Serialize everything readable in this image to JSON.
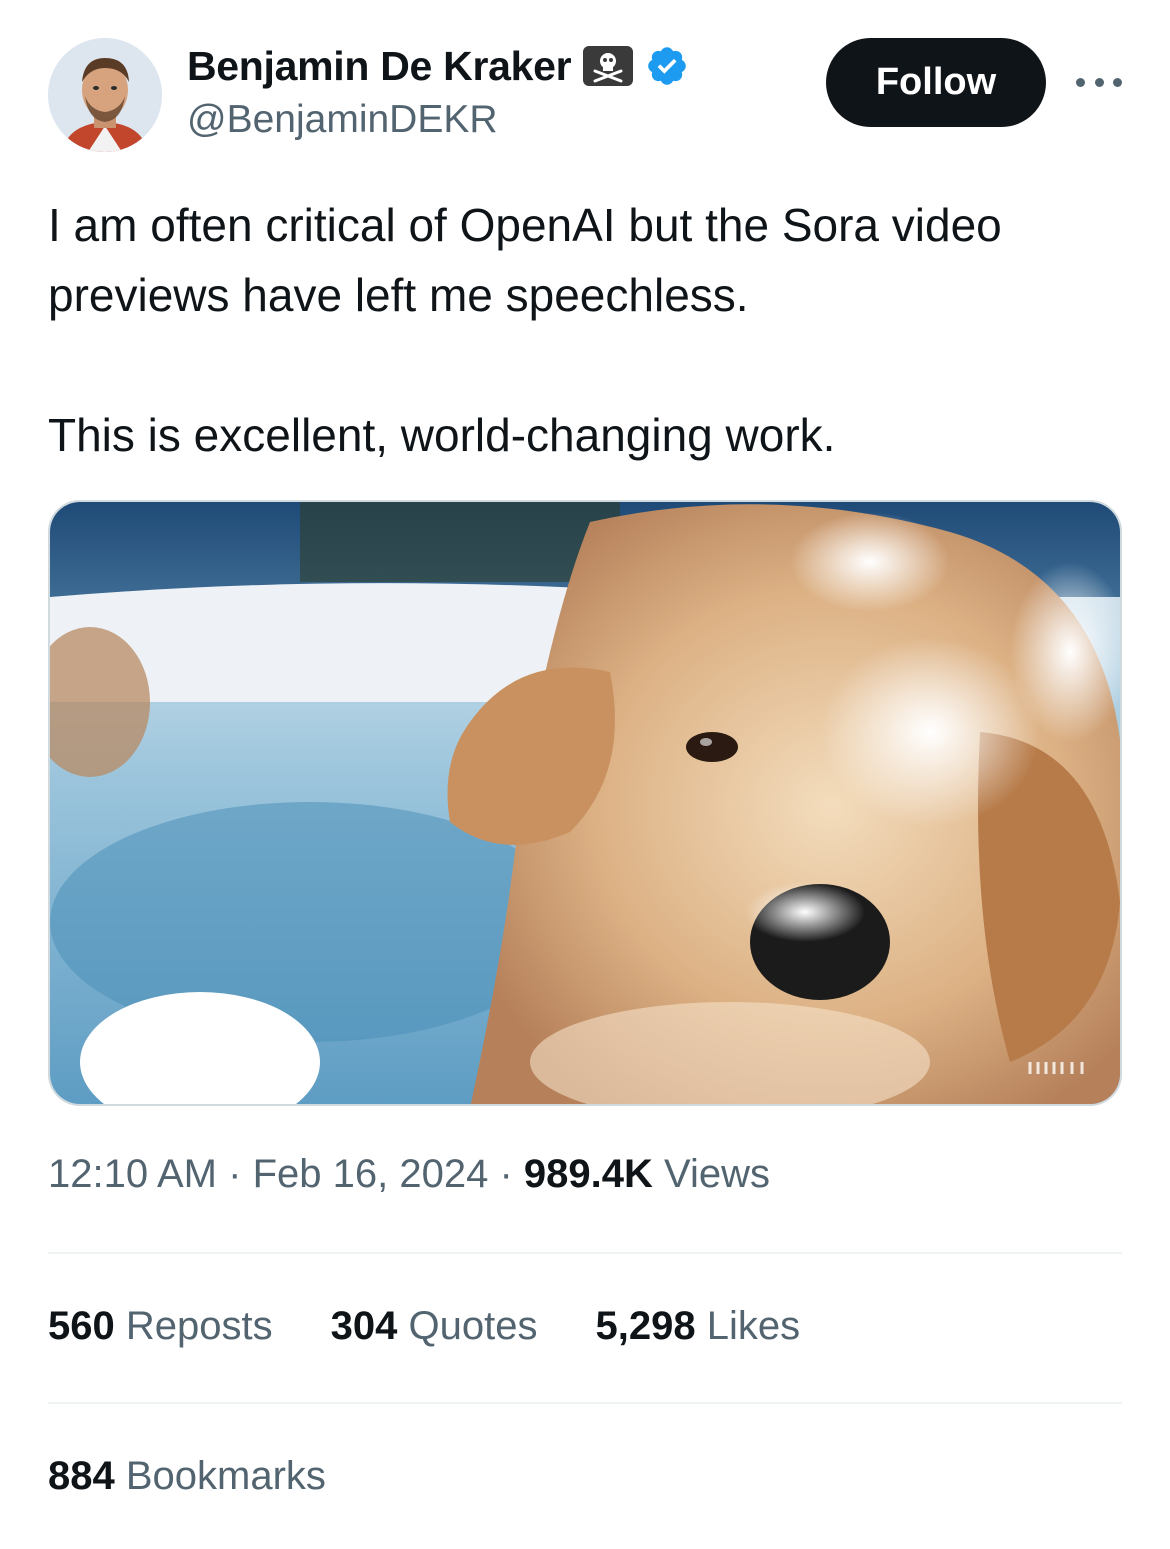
{
  "author": {
    "name": "Benjamin De Kraker",
    "handle": "@BenjaminDEKR",
    "emoji_icon": "skull-crossbones-icon",
    "verified_icon": "verified-badge-icon",
    "verified_color": "#1d9bf0"
  },
  "actions": {
    "follow_label": "Follow",
    "more_icon": "more-dots-icon"
  },
  "tweet": {
    "line1": "I am often critical of OpenAI but the Sora video",
    "line2": "previews have left me speechless.",
    "line3": "This is excellent, world-changing work."
  },
  "media": {
    "type": "video-preview",
    "icon": "video-thumbnail"
  },
  "meta": {
    "time": "12:10 AM",
    "separator": "·",
    "date": "Feb 16, 2024",
    "views_count": "989.4K",
    "views_label": "Views"
  },
  "stats": {
    "reposts_count": "560",
    "reposts_label": "Reposts",
    "quotes_count": "304",
    "quotes_label": "Quotes",
    "likes_count": "5,298",
    "likes_label": "Likes",
    "bookmarks_count": "884",
    "bookmarks_label": "Bookmarks"
  },
  "colors": {
    "text_primary": "#0f1419",
    "text_secondary": "#536471",
    "button_bg": "#0f1419",
    "divider": "#eff3f4"
  }
}
